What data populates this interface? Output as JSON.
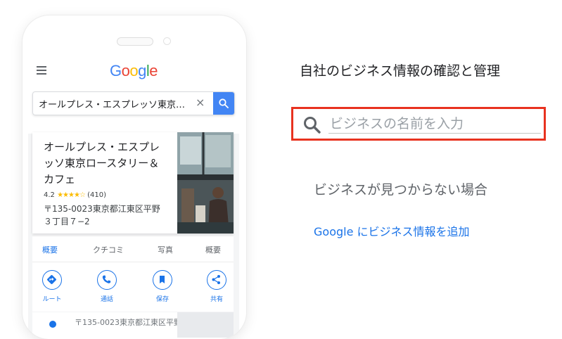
{
  "phone": {
    "logo": [
      "G",
      "o",
      "o",
      "g",
      "l",
      "e"
    ],
    "search_query": "オールプレス・エスプレッソ東京…",
    "clear_symbol": "×",
    "business": {
      "name": "オールプレス・エスプレッソ東京ロースタリー＆カフェ",
      "rating": "4.2",
      "stars": "★★★★☆",
      "review_count": "(410)",
      "address": "〒135-0023東京都江東区平野３丁目７−2"
    },
    "tabs": [
      "概要",
      "クチコミ",
      "写真",
      "概要"
    ],
    "actions": [
      {
        "label": "ルート",
        "icon": "directions-icon"
      },
      {
        "label": "通話",
        "icon": "phone-icon"
      },
      {
        "label": "保存",
        "icon": "bookmark-icon"
      },
      {
        "label": "共有",
        "icon": "share-icon"
      }
    ],
    "next_row_text": "〒135-0023東京都江東区平野"
  },
  "panel": {
    "heading": "自社のビジネス情報の確認と管理",
    "search_placeholder": "ビジネスの名前を入力",
    "not_found_text": "ビジネスが見つからない場合",
    "add_link": "Google にビジネス情報を追加"
  },
  "colors": {
    "accent": "#1a73e8",
    "search_highlight": "#e8321f",
    "google_blue": "#4285F4",
    "google_red": "#EA4335",
    "google_yellow": "#FBBC05",
    "google_green": "#34A853",
    "star": "#fbbc04"
  }
}
